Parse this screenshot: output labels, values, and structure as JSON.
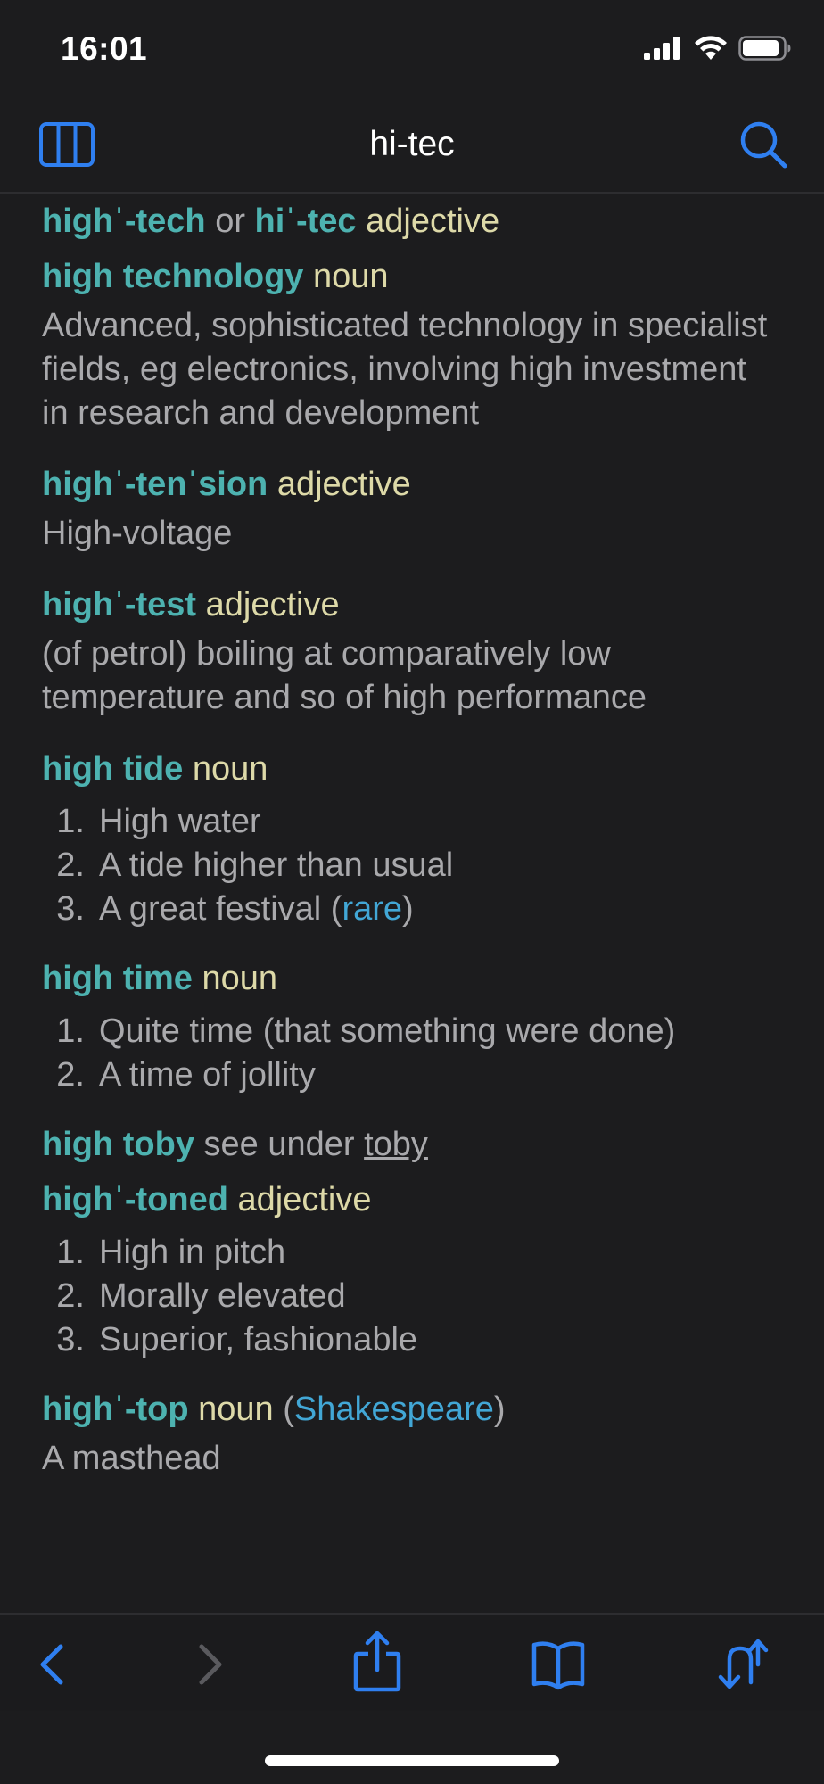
{
  "status_bar": {
    "time": "16:01"
  },
  "nav": {
    "title": "hi-tec"
  },
  "entries": [
    {
      "headword": "highˈ-tech",
      "or": " or ",
      "alt": "hiˈ-tec",
      "pos": " adjective"
    },
    {
      "headword": "high technology",
      "pos": " noun",
      "definition": "Advanced, sophisticated technology in specialist fields, eg electronics, involving high investment in research and development"
    },
    {
      "headword": "highˈ-tenˈsion",
      "pos": " adjective",
      "definition": "High-voltage"
    },
    {
      "headword": "highˈ-test",
      "pos": " adjective",
      "definition": "(of petrol) boiling at comparatively low temperature and so of high performance"
    },
    {
      "headword": "high tide",
      "pos": " noun",
      "senses": [
        {
          "num": "1.",
          "text": "High water"
        },
        {
          "num": "2.",
          "text": "A tide higher than usual"
        },
        {
          "num": "3.",
          "text": "A great festival (",
          "link": "rare",
          "after": ")"
        }
      ]
    },
    {
      "headword": "high time",
      "pos": " noun",
      "senses": [
        {
          "num": "1.",
          "text": "Quite time (that something were done)"
        },
        {
          "num": "2.",
          "text": "A time of jollity"
        }
      ]
    },
    {
      "headword": "high toby",
      "see": " see under ",
      "xref": "toby"
    },
    {
      "headword": "highˈ-toned",
      "pos": " adjective",
      "senses": [
        {
          "num": "1.",
          "text": "High in pitch"
        },
        {
          "num": "2.",
          "text": "Morally elevated"
        },
        {
          "num": "3.",
          "text": "Superior, fashionable"
        }
      ]
    },
    {
      "headword": "highˈ-top",
      "pos": " noun",
      "open": " (",
      "label": "Shakespeare",
      "close": ")",
      "definition": "A masthead"
    }
  ],
  "colors": {
    "headword": "#4db2b0",
    "pos": "#ddd9a8",
    "link": "#42a7d6",
    "accent": "#2f7ff0",
    "text": "#a9a9ac",
    "background": "#1c1c1e"
  },
  "icons": {
    "nav_left": "columns-icon",
    "nav_right": "search-icon",
    "toolbar": [
      "chevron-left-icon",
      "chevron-right-icon",
      "share-icon",
      "book-icon",
      "swap-arrows-icon"
    ]
  }
}
